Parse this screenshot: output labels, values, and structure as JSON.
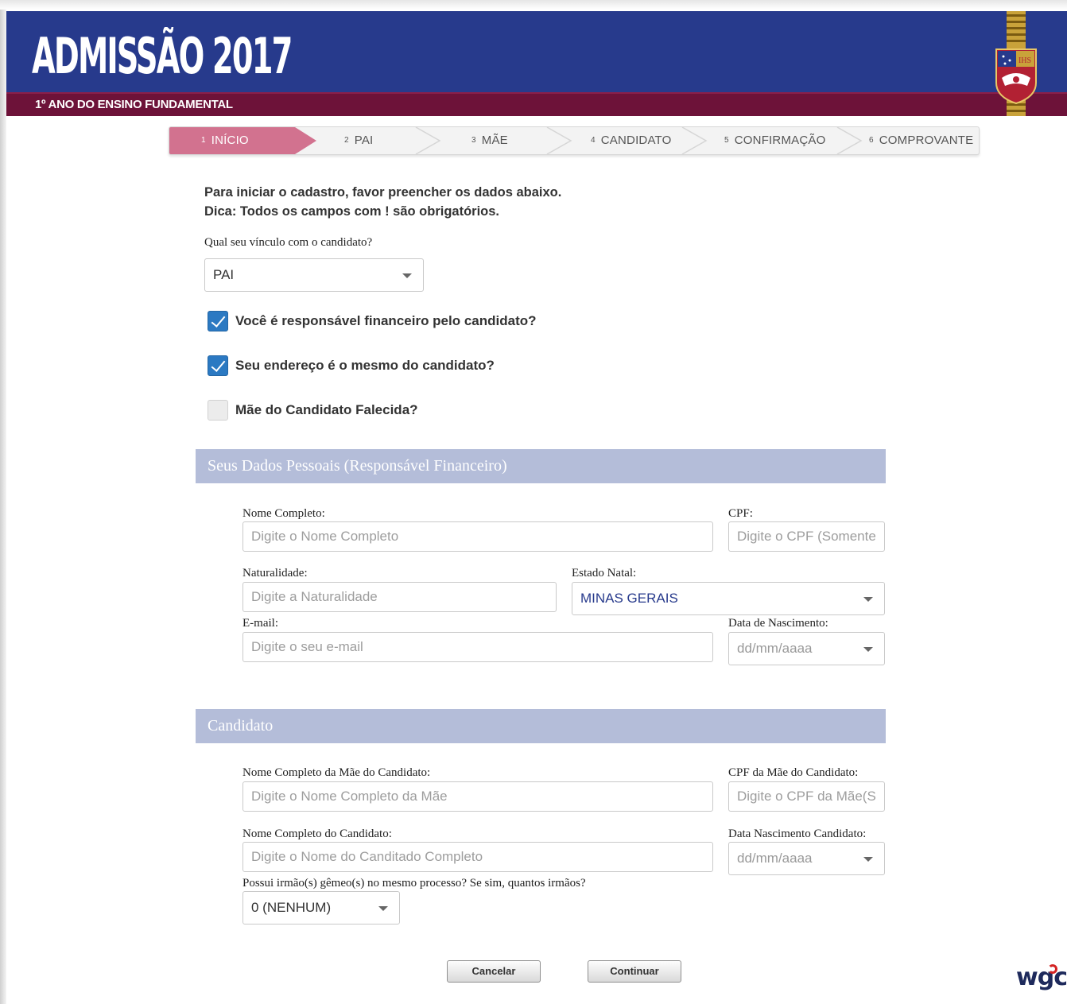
{
  "header": {
    "title": "ADMISSÃO 2017",
    "subtitle": "1º ANO DO ENSINO FUNDAMENTAL",
    "crest_text": "IHS"
  },
  "steps": [
    {
      "num": "1",
      "label": "INÍCIO",
      "active": true
    },
    {
      "num": "2",
      "label": "PAI",
      "active": false
    },
    {
      "num": "3",
      "label": "MÃE",
      "active": false
    },
    {
      "num": "4",
      "label": "CANDIDATO",
      "active": false
    },
    {
      "num": "5",
      "label": "CONFIRMAÇÃO",
      "active": false
    },
    {
      "num": "6",
      "label": "COMPROVANTE",
      "active": false
    }
  ],
  "intro": {
    "line1": "Para iniciar o cadastro, favor preencher os dados abaixo.",
    "line2": "Dica: Todos os campos com ! são obrigatórios."
  },
  "relationship": {
    "label": "Qual seu vínculo com o candidato?",
    "value": "PAI"
  },
  "checkboxes": [
    {
      "label": "Você é responsável financeiro pelo candidato?",
      "checked": true
    },
    {
      "label": "Seu endereço é o mesmo do candidato?",
      "checked": true
    },
    {
      "label": "Mãe do Candidato Falecida?",
      "checked": false
    }
  ],
  "personal_section": {
    "title": "Seus Dados Pessoais (Responsável Financeiro)",
    "full_name": {
      "label": "Nome Completo:",
      "placeholder": "Digite o Nome Completo",
      "value": ""
    },
    "cpf": {
      "label": "CPF:",
      "placeholder": "Digite o CPF (Somente",
      "value": ""
    },
    "birthplace": {
      "label": "Naturalidade:",
      "placeholder": "Digite a Naturalidade",
      "value": ""
    },
    "home_state": {
      "label": "Estado Natal:",
      "value": "MINAS GERAIS"
    },
    "email": {
      "label": "E-mail:",
      "placeholder": "Digite o seu e-mail",
      "value": ""
    },
    "birth_date": {
      "label": "Data de Nascimento:",
      "placeholder": "dd/mm/aaaa"
    }
  },
  "candidate_section": {
    "title": "Candidato",
    "mother_name": {
      "label": "Nome Completo da Mãe do Candidato:",
      "placeholder": "Digite o Nome Completo da Mãe",
      "value": ""
    },
    "mother_cpf": {
      "label": "CPF da Mãe do Candidato:",
      "placeholder": "Digite o CPF da Mãe(Sc",
      "value": ""
    },
    "candidate_name": {
      "label": "Nome Completo do Candidato:",
      "placeholder": "Digite o Nome do Canditado Completo",
      "value": ""
    },
    "candidate_birth": {
      "label": "Data Nascimento Candidato:",
      "placeholder": "dd/mm/aaaa"
    },
    "twins": {
      "label": "Possui irmão(s) gêmeo(s) no mesmo processo? Se sim, quantos irmãos?",
      "value": "0 (NENHUM)"
    }
  },
  "buttons": {
    "cancel": "Cancelar",
    "continue": "Continuar"
  },
  "footer": {
    "logo_text": "wgc"
  },
  "colors": {
    "header_blue": "#273a8c",
    "header_wine": "#6d1239",
    "active_step": "#d2728f",
    "section_bar": "#b4bdd9",
    "checkbox_on": "#2b79c2"
  }
}
